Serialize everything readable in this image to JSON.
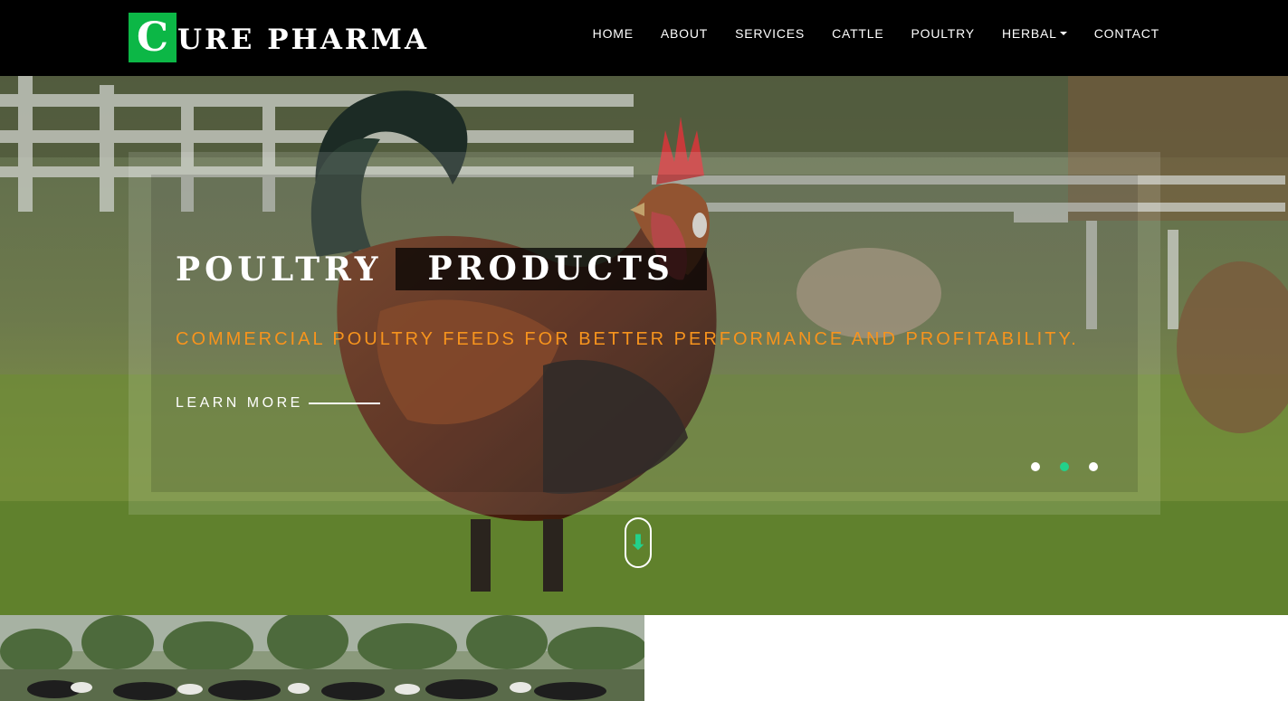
{
  "brand": {
    "initial": "C",
    "rest": "URE PHARMA",
    "initial_bg": "#0cb746"
  },
  "nav": {
    "items": [
      {
        "label": "HOME"
      },
      {
        "label": "ABOUT"
      },
      {
        "label": "SERVICES"
      },
      {
        "label": "CATTLE"
      },
      {
        "label": "POULTRY"
      },
      {
        "label": "HERBAL",
        "has_dropdown": true
      },
      {
        "label": "CONTACT"
      }
    ]
  },
  "hero": {
    "title_word1": "POULTRY",
    "title_word2": "PRODUCTS",
    "subtitle": "COMMERCIAL POULTRY FEEDS FOR BETTER PERFORMANCE AND PROFITABILITY.",
    "cta_label": "LEARN MORE",
    "slides_count": 3,
    "active_slide": 2,
    "scroll_icon": "arrow-down-icon",
    "colors": {
      "accent": "#23d18b",
      "subtitle": "#f7941d"
    }
  }
}
